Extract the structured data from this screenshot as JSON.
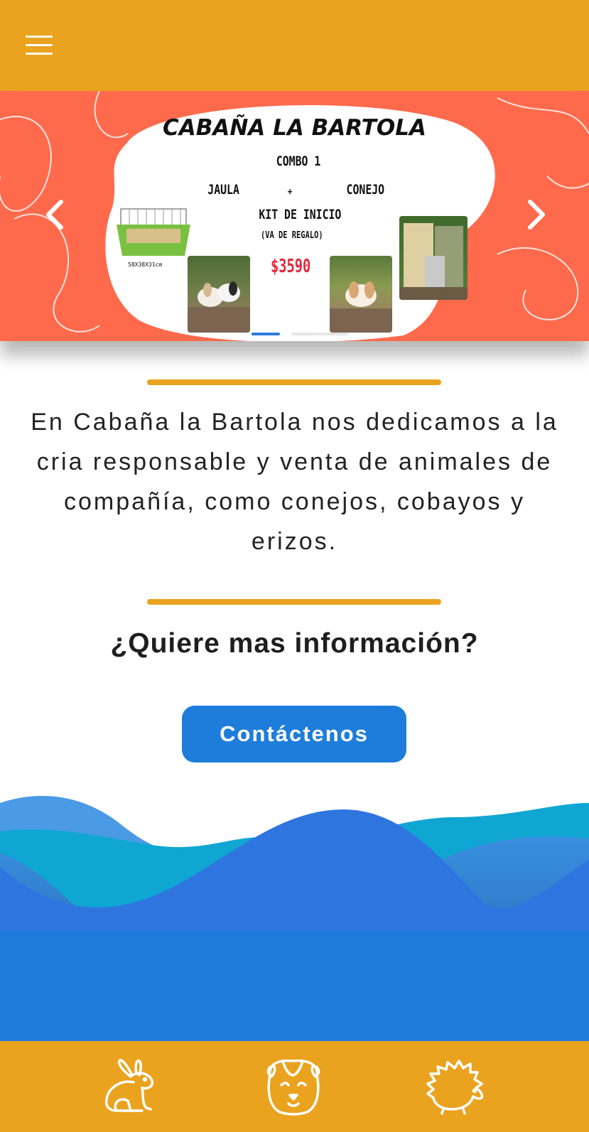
{
  "header": {
    "menu_icon": "hamburger-menu-icon"
  },
  "carousel": {
    "title": "CABAÑA LA BARTOLA",
    "combo": "COMBO 1",
    "item_left": "JAULA",
    "plus": "+",
    "item_right": "CONEJO",
    "kit": "KIT DE INICIO",
    "gift": "(VA DE REGALO)",
    "price": "$3590",
    "cage_size": "58X38X31cm",
    "prev_icon": "chevron-left-icon",
    "next_icon": "chevron-right-icon",
    "slides": 3,
    "active_slide": 1,
    "colors": {
      "background": "#ff6a4c",
      "price": "#e8273c",
      "cage": "#7ac142"
    }
  },
  "intro": {
    "text": "En Cabaña la Bartola nos dedicamos a la cria responsable y venta de animales de compañía, como conejos, cobayos y erizos."
  },
  "cta": {
    "question": "¿Quiere mas información?",
    "button_label": "Contáctenos"
  },
  "footer_nav": [
    {
      "icon": "rabbit-icon"
    },
    {
      "icon": "guinea-pig-icon"
    },
    {
      "icon": "hedgehog-icon"
    }
  ],
  "colors": {
    "accent": "#eaa31e",
    "button": "#1e7ddb",
    "wave": "#2a7be0"
  }
}
